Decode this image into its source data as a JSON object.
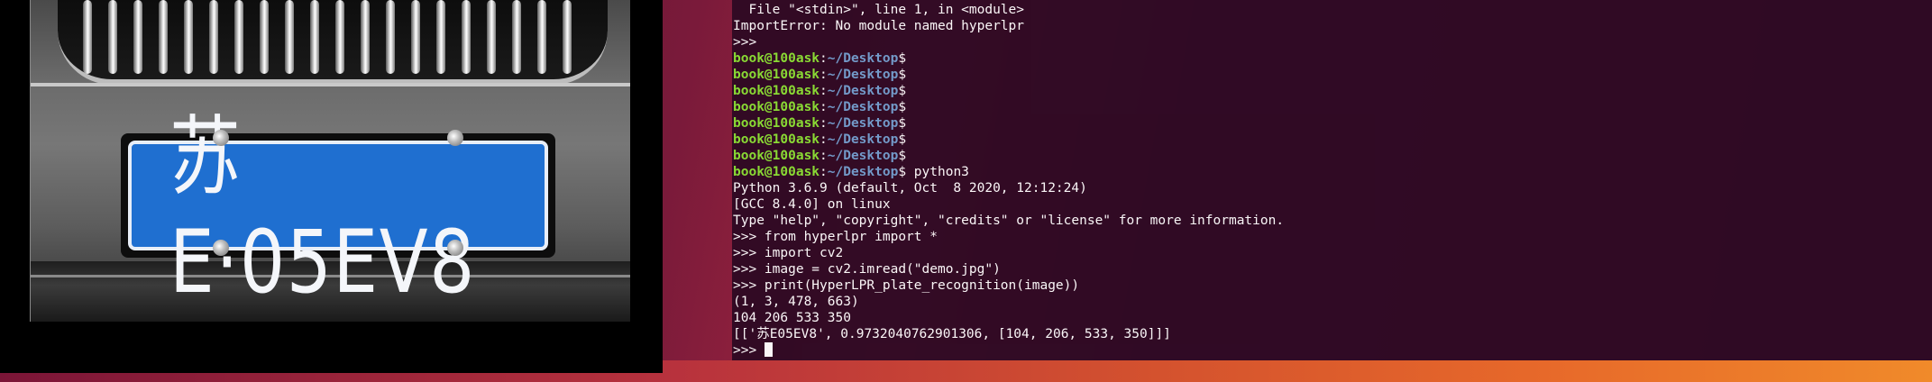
{
  "image_viewer": {
    "plate_text": "苏E·05EV8"
  },
  "terminal": {
    "prompt_user_host": "book@100ask",
    "prompt_sep": ":",
    "prompt_path": "~/Desktop",
    "prompt_symbol": "$",
    "lines": [
      "  File \"<stdin>\", line 1, in <module>",
      "ImportError: No module named hyperlpr",
      ">>> ",
      "",
      "",
      "",
      "",
      "",
      "",
      "",
      " python3",
      "Python 3.6.9 (default, Oct  8 2020, 12:12:24)",
      "[GCC 8.4.0] on linux",
      "Type \"help\", \"copyright\", \"credits\" or \"license\" for more information.",
      ">>> from hyperlpr import *",
      ">>> import cv2",
      ">>> image = cv2.imread(\"demo.jpg\")",
      ">>> print(HyperLPR_plate_recognition(image))",
      "(1, 3, 478, 663)",
      "104 206 533 350",
      "[['苏E05EV8', 0.9732040762901306, [104, 206, 533, 350]]]",
      ">>> "
    ],
    "colors": {
      "background": "#2f0a24",
      "user_host": "#8ae234",
      "path": "#729fcf",
      "text": "#ffffff"
    }
  }
}
